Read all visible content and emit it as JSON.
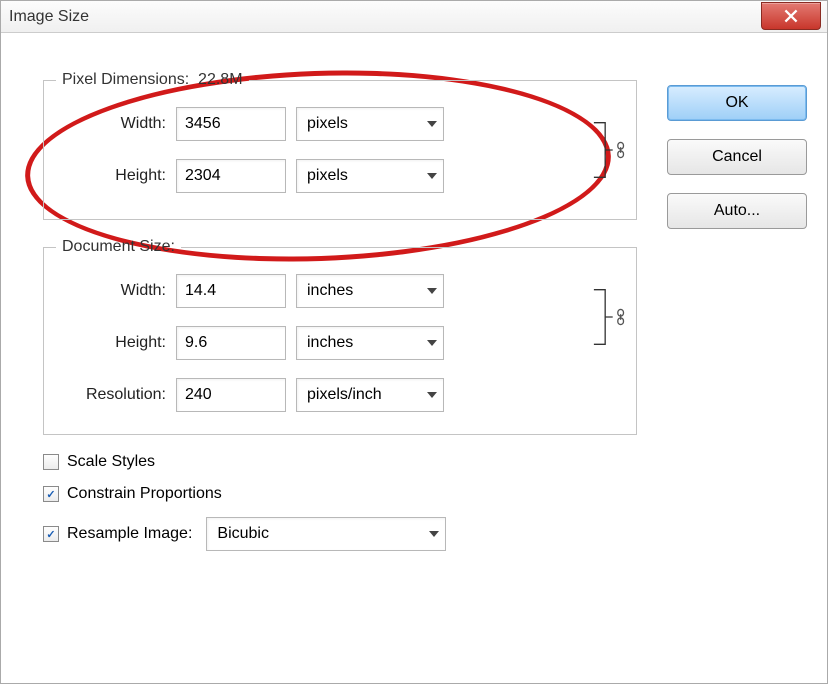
{
  "window": {
    "title": "Image Size"
  },
  "pixel_dimensions": {
    "legend": "Pixel Dimensions:",
    "size_text": "22.8M",
    "width_label": "Width:",
    "width_value": "3456",
    "width_unit": "pixels",
    "height_label": "Height:",
    "height_value": "2304",
    "height_unit": "pixels"
  },
  "document_size": {
    "legend": "Document Size:",
    "width_label": "Width:",
    "width_value": "14.4",
    "width_unit": "inches",
    "height_label": "Height:",
    "height_value": "9.6",
    "height_unit": "inches",
    "resolution_label": "Resolution:",
    "resolution_value": "240",
    "resolution_unit": "pixels/inch"
  },
  "checks": {
    "scale_styles_label": "Scale Styles",
    "scale_styles_checked": false,
    "constrain_label": "Constrain Proportions",
    "constrain_checked": true,
    "resample_label": "Resample Image:",
    "resample_checked": true,
    "resample_method": "Bicubic"
  },
  "buttons": {
    "ok": "OK",
    "cancel": "Cancel",
    "auto": "Auto..."
  }
}
